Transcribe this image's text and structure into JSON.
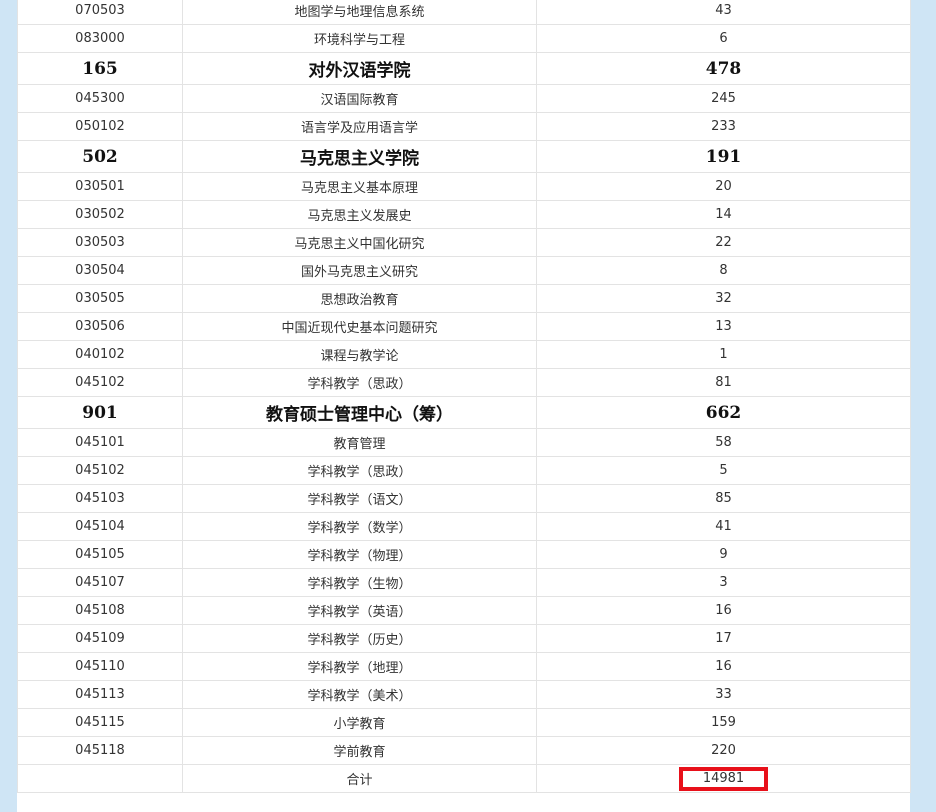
{
  "rows": [
    {
      "type": "major",
      "code": "070503",
      "name": "地图学与地理信息系统",
      "count": "43"
    },
    {
      "type": "major",
      "code": "083000",
      "name": "环境科学与工程",
      "count": "6"
    },
    {
      "type": "dept",
      "code": "165",
      "name": "对外汉语学院",
      "count": "478"
    },
    {
      "type": "major",
      "code": "045300",
      "name": "汉语国际教育",
      "count": "245"
    },
    {
      "type": "major",
      "code": "050102",
      "name": "语言学及应用语言学",
      "count": "233"
    },
    {
      "type": "dept",
      "code": "502",
      "name": "马克思主义学院",
      "count": "191"
    },
    {
      "type": "major",
      "code": "030501",
      "name": "马克思主义基本原理",
      "count": "20"
    },
    {
      "type": "major",
      "code": "030502",
      "name": "马克思主义发展史",
      "count": "14"
    },
    {
      "type": "major",
      "code": "030503",
      "name": "马克思主义中国化研究",
      "count": "22"
    },
    {
      "type": "major",
      "code": "030504",
      "name": "国外马克思主义研究",
      "count": "8"
    },
    {
      "type": "major",
      "code": "030505",
      "name": "思想政治教育",
      "count": "32"
    },
    {
      "type": "major",
      "code": "030506",
      "name": "中国近现代史基本问题研究",
      "count": "13"
    },
    {
      "type": "major",
      "code": "040102",
      "name": "课程与教学论",
      "count": "1"
    },
    {
      "type": "major",
      "code": "045102",
      "name": "学科教学（思政）",
      "count": "81"
    },
    {
      "type": "dept",
      "code": "901",
      "name": "教育硕士管理中心（筹）",
      "count": "662"
    },
    {
      "type": "major",
      "code": "045101",
      "name": "教育管理",
      "count": "58"
    },
    {
      "type": "major",
      "code": "045102",
      "name": "学科教学（思政）",
      "count": "5"
    },
    {
      "type": "major",
      "code": "045103",
      "name": "学科教学（语文）",
      "count": "85"
    },
    {
      "type": "major",
      "code": "045104",
      "name": "学科教学（数学）",
      "count": "41"
    },
    {
      "type": "major",
      "code": "045105",
      "name": "学科教学（物理）",
      "count": "9"
    },
    {
      "type": "major",
      "code": "045107",
      "name": "学科教学（生物）",
      "count": "3"
    },
    {
      "type": "major",
      "code": "045108",
      "name": "学科教学（英语）",
      "count": "16"
    },
    {
      "type": "major",
      "code": "045109",
      "name": "学科教学（历史）",
      "count": "17"
    },
    {
      "type": "major",
      "code": "045110",
      "name": "学科教学（地理）",
      "count": "16"
    },
    {
      "type": "major",
      "code": "045113",
      "name": "学科教学（美术）",
      "count": "33"
    },
    {
      "type": "major",
      "code": "045115",
      "name": "小学教育",
      "count": "159"
    },
    {
      "type": "major",
      "code": "045118",
      "name": "学前教育",
      "count": "220"
    }
  ],
  "total": {
    "label": "合计",
    "value": "14981",
    "highlight_color": "#e8101a"
  }
}
